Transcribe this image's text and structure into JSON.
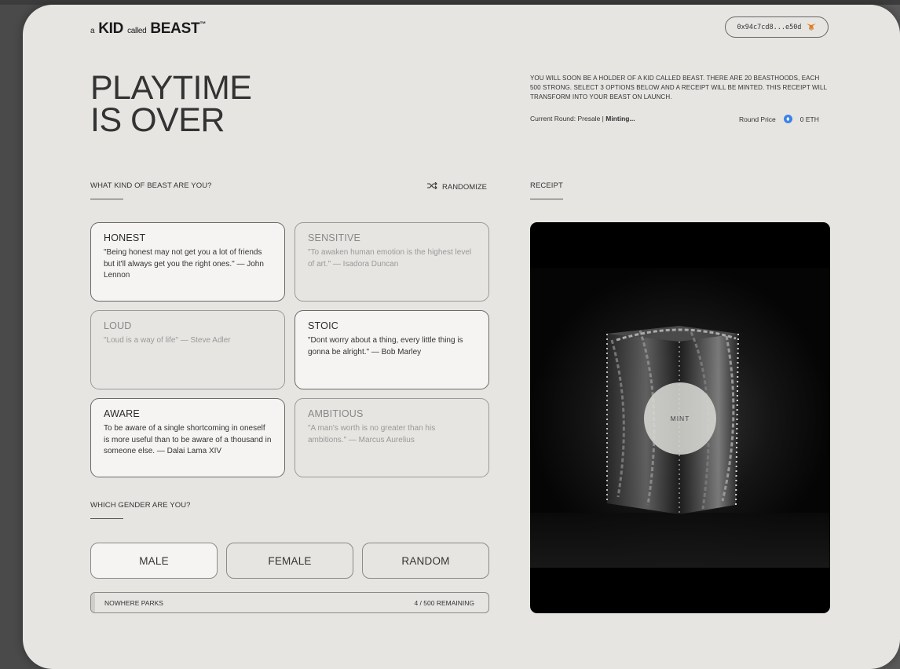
{
  "brand": {
    "prefix": "a",
    "word1": "KID",
    "middle": "called",
    "word2": "BEAST",
    "tm": "™"
  },
  "wallet": {
    "address": "0x94c7cd8...e50d",
    "icon": "metamask-fox-icon"
  },
  "hero": {
    "line1": "PLAYTIME",
    "line2": "IS OVER"
  },
  "intro": {
    "text": "YOU WILL SOON BE A HOLDER OF A KID CALLED BEAST. THERE ARE 20 BEASTHOODS, EACH 500 STRONG. SELECT 3 OPTIONS BELOW AND A RECEIPT WILL BE MINTED. THIS RECEIPT WILL TRANSFORM INTO YOUR BEAST ON LAUNCH."
  },
  "round": {
    "label": "Current Round: Presale",
    "separator": "|",
    "status": "Minting..."
  },
  "price": {
    "label": "Round Price",
    "value": "0 ETH",
    "icon": "eth-icon"
  },
  "traits": {
    "heading": "WHAT KIND OF BEAST ARE YOU?",
    "randomize_label": "RANDOMIZE",
    "items": [
      {
        "title": "HONEST",
        "quote": "\"Being honest may not get you a lot of friends but it'll always get you the right ones.\" — John Lennon",
        "selected": true
      },
      {
        "title": "SENSITIVE",
        "quote": "\"To awaken human emotion is the highest level of art.\" — Isadora Duncan",
        "selected": false
      },
      {
        "title": "LOUD",
        "quote": "\"Loud is a way of life\" — Steve Adler",
        "selected": false
      },
      {
        "title": "STOIC",
        "quote": "\"Dont worry about a thing, every little thing is gonna be alright.\" — Bob Marley",
        "selected": true
      },
      {
        "title": "AWARE",
        "quote": "To be aware of a single shortcoming in oneself is more useful than to be aware of a thousand in someone else. — Dalai Lama XIV",
        "selected": true
      },
      {
        "title": "AMBITIOUS",
        "quote": "\"A man's worth is no greater than his ambitions.\" — Marcus Aurelius",
        "selected": false
      }
    ]
  },
  "gender": {
    "heading": "WHICH GENDER ARE YOU?",
    "options": [
      "MALE",
      "FEMALE",
      "RANDOM"
    ],
    "selected": "MALE"
  },
  "beasthood": {
    "name": "NOWHERE PARKS",
    "remaining_text": "4 / 500 REMAINING",
    "remaining": 4,
    "total": 500
  },
  "receipt": {
    "heading": "RECEIPT",
    "mint_label": "MINT"
  },
  "colors": {
    "card_bg": "#e6e5e2",
    "eth_blue": "#3b82e6",
    "selected_card": "#f5f4f2"
  }
}
